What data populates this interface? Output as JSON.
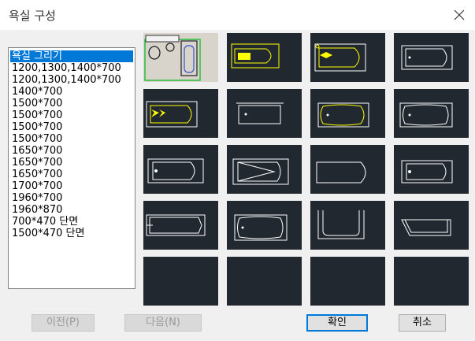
{
  "window": {
    "title": "욕실 구성"
  },
  "list": {
    "selected_index": 0,
    "items": [
      "욕실 그리기",
      "1200,1300,1400*700",
      "1200,1300,1400*700",
      "1400*700",
      "1500*700",
      "1500*700",
      "1500*700",
      "1500*700",
      "1650*700",
      "1650*700",
      "1650*700",
      "1700*700",
      "1960*700",
      "1960*870",
      "700*470 단면",
      "1500*470 단면"
    ]
  },
  "buttons": {
    "prev": "이전(P)",
    "next": "다음(N)",
    "ok": "확인",
    "cancel": "취소"
  },
  "colors": {
    "thumb_bg": "#212830",
    "selection": "#0078d7",
    "highlight": "#ffff00"
  }
}
